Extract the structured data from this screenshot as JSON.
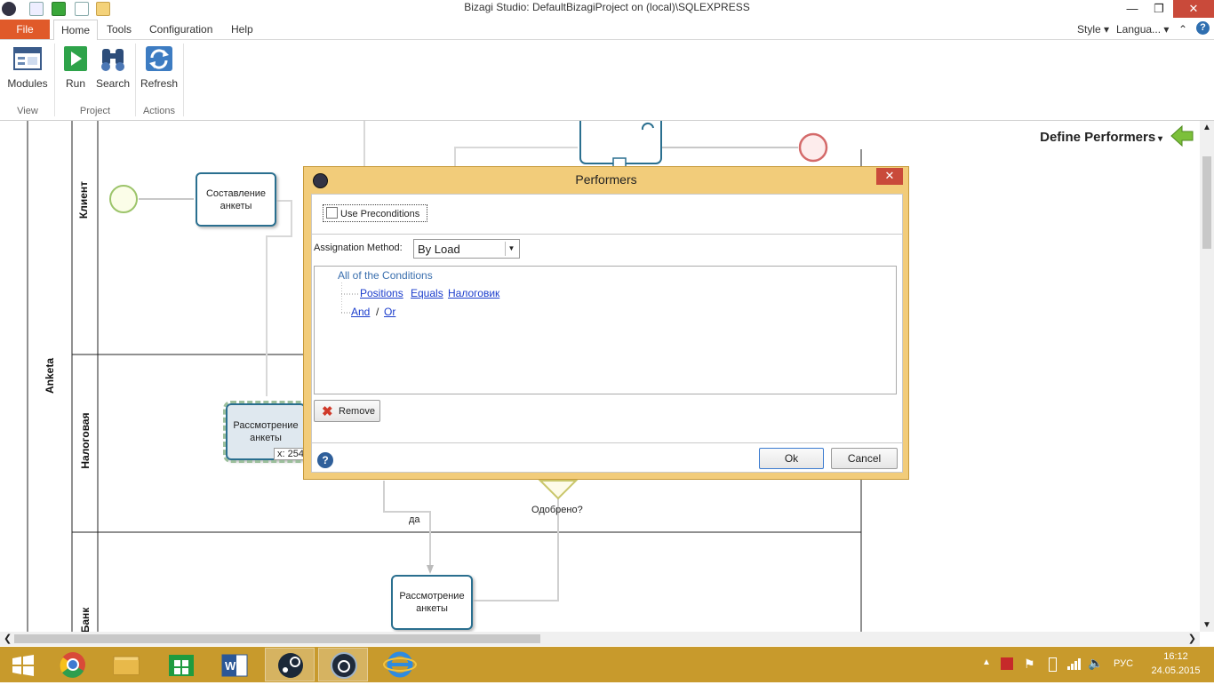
{
  "window": {
    "title": "Bizagi Studio: DefaultBizagiProject on (local)\\SQLEXPRESS"
  },
  "menu": {
    "file": "File",
    "tabs": [
      "Home",
      "Tools",
      "Configuration",
      "Help"
    ],
    "style": "Style",
    "language": "Langua..."
  },
  "ribbon": {
    "buttons": {
      "modules": "Modules",
      "run": "Run",
      "search": "Search",
      "refresh": "Refresh"
    },
    "groups": {
      "view": "View",
      "project": "Project",
      "actions": "Actions"
    }
  },
  "canvas": {
    "define_performers": "Define Performers",
    "pool": "Anketa",
    "lanes": [
      "Клиент",
      "Налоговая",
      "Банк"
    ],
    "tasks": {
      "task1": "Составление анкеты",
      "task2": "Рассмотрение анкеты",
      "task3": "Рассмотрение анкеты"
    },
    "gateway_label": "Одобрено?",
    "flow_label_yes": "да",
    "coord_tooltip": "x: 254"
  },
  "dialog": {
    "title": "Performers",
    "use_preconditions": "Use Preconditions",
    "assignation_label": "Assignation Method:",
    "assignation_value": "By Load",
    "tree": {
      "root": "All of the Conditions",
      "condition": {
        "field": "Positions",
        "op": "Equals",
        "value": "Налоговик"
      },
      "and": "And",
      "sep": "/",
      "or": "Or"
    },
    "remove": "Remove",
    "ok": "Ok",
    "cancel": "Cancel"
  },
  "taskbar": {
    "lang": "РУС",
    "time": "16:12",
    "date": "24.05.2015"
  },
  "colors": {
    "file_tab": "#e05a2a",
    "taskbar": "#c89a2c",
    "dialog_frame": "#f2cc7a",
    "task_border": "#2a6f8f"
  }
}
